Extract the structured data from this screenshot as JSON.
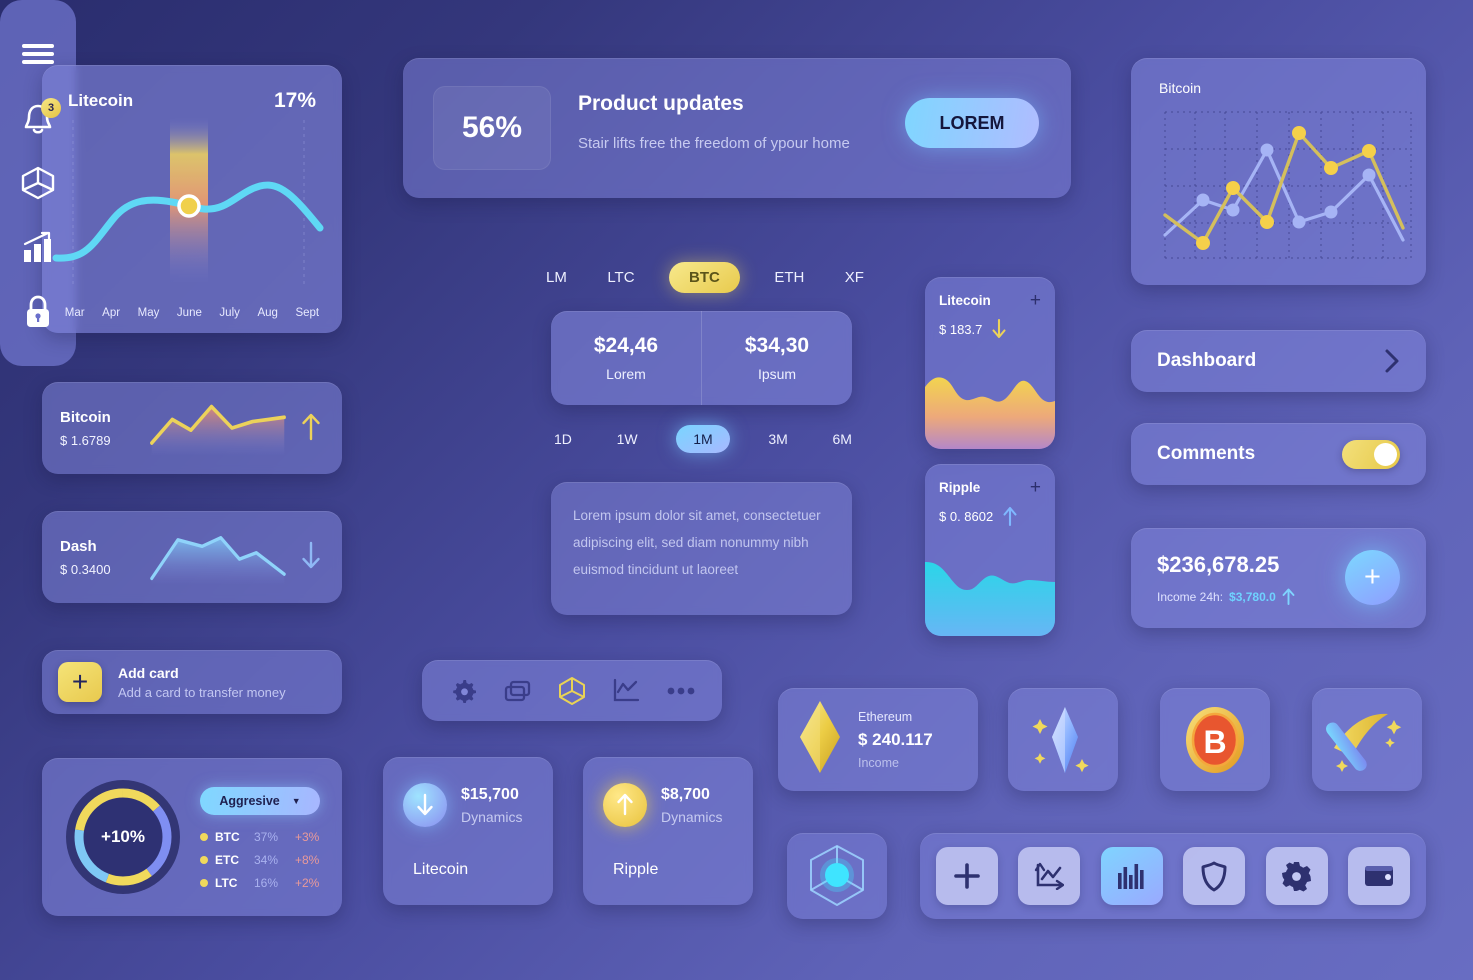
{
  "litecoin_chart": {
    "name": "Litecoin",
    "percent": "17%",
    "months": [
      "Mar",
      "Apr",
      "May",
      "June",
      "July",
      "Aug",
      "Sept"
    ]
  },
  "coin_rows": [
    {
      "name": "Bitcoin",
      "value": "$ 1.6789",
      "trend": "up",
      "arrow": "↑",
      "color": "#ecd25a"
    },
    {
      "name": "Dash",
      "value": "$ 0.3400",
      "trend": "down",
      "arrow": "↓",
      "color": "#7fc8f5"
    }
  ],
  "add_card": {
    "title": "Add card",
    "subtitle": "Add a card to transfer money",
    "plus": "+"
  },
  "portfolio": {
    "center_label": "+10%",
    "selector": "Aggresive",
    "chevron": "▼",
    "legend": [
      {
        "symbol": "BTC",
        "pct": "37%",
        "change": "+3%"
      },
      {
        "symbol": "ETC",
        "pct": "34%",
        "change": "+8%"
      },
      {
        "symbol": "LTC",
        "pct": "16%",
        "change": "+2%"
      }
    ]
  },
  "promo": {
    "percent": "56%",
    "title": "Product updates",
    "subtitle": "Stair lifts free the freedom of ypour home",
    "button": "LOREM"
  },
  "vnav": {
    "items": [
      "menu-icon",
      "bell-icon",
      "cube-icon",
      "bar-chart-icon",
      "lock-icon"
    ],
    "badge": "3"
  },
  "coin_tabs": {
    "items": [
      "LM",
      "LTC",
      "BTC",
      "ETH",
      "XF"
    ],
    "active": "BTC"
  },
  "price_pair": [
    {
      "value": "$24,46",
      "label": "Lorem"
    },
    {
      "value": "$34,30",
      "label": "Ipsum"
    }
  ],
  "range_tabs": {
    "items": [
      "1D",
      "1W",
      "1M",
      "3M",
      "6M"
    ],
    "active": "1M"
  },
  "lorem_block": "Lorem ipsum dolor sit amet, consectetuer adipiscing elit, sed diam nonummy nibh euismod tincidunt ut laoreet",
  "mini_cards": [
    {
      "name": "Litecoin",
      "price": "$ 183.7",
      "arrow": "↓",
      "plus": "+"
    },
    {
      "name": "Ripple",
      "price": "$ 0. 8602",
      "arrow": "↑",
      "plus": "+"
    }
  ],
  "bitcoin_chart": {
    "label": "Bitcoin"
  },
  "dashboard": {
    "label": "Dashboard",
    "chevron": "❯"
  },
  "comments": {
    "label": "Comments",
    "toggle_on": true
  },
  "balance": {
    "amount": "$236,678.25",
    "income_label": "Income 24h:",
    "income_value": "$3,780.0",
    "income_arrow": "↑",
    "fab": "+"
  },
  "icon_strip": {
    "items": [
      "gear-icon",
      "copy-icon",
      "cube-icon",
      "line-chart-icon",
      "more-icon"
    ],
    "active": "cube-icon"
  },
  "dynamics": [
    {
      "amount": "$15,700",
      "sub": "Dynamics",
      "name": "Litecoin",
      "arrow": "↓",
      "accent": "#7fbaff"
    },
    {
      "amount": "$8,700",
      "sub": "Dynamics",
      "name": "Ripple",
      "arrow": "↑",
      "accent": "#f0d44f"
    }
  ],
  "ethereum": {
    "name": "Ethereum",
    "price": "$ 240.117",
    "sub": "Income"
  },
  "tiles": [
    "crystal-icon",
    "bitcoin-coin-icon",
    "mining-pickaxe-icon"
  ],
  "bottom_toolbar": {
    "items": [
      "plus-icon",
      "line-chart-icon",
      "bar-chart-icon",
      "shield-icon",
      "gear-icon",
      "wallet-icon"
    ],
    "active": "bar-chart-icon"
  },
  "cube_tile": {
    "icon": "cube-glow-icon"
  },
  "colors": {
    "background_dark": "#2a2d6e",
    "background_light": "#686dc2",
    "card": "#7e83d7",
    "accent_yellow": "#ecd25a",
    "accent_blue": "#7fd4ff",
    "text": "#ffffff"
  },
  "chart_data": [
    {
      "type": "line",
      "title": "Litecoin",
      "x": [
        "Mar",
        "Apr",
        "May",
        "June",
        "July",
        "Aug",
        "Sept"
      ],
      "values": [
        18,
        22,
        58,
        55,
        52,
        68,
        46
      ],
      "ylim": [
        0,
        100
      ],
      "grid": false,
      "highlight_point": {
        "x": "June",
        "y": 55
      },
      "series_color": "#5fd8f5"
    },
    {
      "type": "area",
      "title": "Bitcoin",
      "values": [
        20,
        48,
        34,
        78,
        52,
        60,
        58,
        66
      ],
      "ylim": [
        0,
        100
      ],
      "series_color": "#ecd25a"
    },
    {
      "type": "area",
      "title": "Dash",
      "values": [
        18,
        72,
        62,
        70,
        42,
        50,
        34,
        22
      ],
      "ylim": [
        0,
        100
      ],
      "series_color": "#7fc8f5"
    },
    {
      "type": "line",
      "title": "Bitcoin",
      "x": [
        1,
        2,
        3,
        4,
        5,
        6,
        7,
        8,
        9
      ],
      "series": [
        {
          "name": "yellow",
          "values": [
            45,
            18,
            62,
            38,
            88,
            70,
            78,
            40,
            null
          ],
          "color": "#f5d04a"
        },
        {
          "name": "blue",
          "values": [
            30,
            44,
            48,
            17,
            55,
            50,
            64,
            22,
            null
          ],
          "color": "#a6b4f5"
        }
      ],
      "ylim": [
        0,
        100
      ],
      "grid": true,
      "legend": "none"
    },
    {
      "type": "area",
      "title": "Litecoin",
      "values": [
        72,
        78,
        55,
        48,
        58,
        52,
        70,
        66,
        52,
        55
      ],
      "ylim": [
        0,
        100
      ],
      "series_color": "#f0cf4e"
    },
    {
      "type": "area",
      "title": "Ripple",
      "values": [
        78,
        72,
        52,
        48,
        56,
        70,
        60,
        62,
        60,
        60
      ],
      "ylim": [
        0,
        100
      ],
      "series_color": "#45cdf0"
    },
    {
      "type": "pie",
      "title": "Portfolio",
      "center_label": "+10%",
      "categories": [
        "BTC",
        "ETC",
        "LTC"
      ],
      "values": [
        37,
        34,
        16
      ],
      "colors": [
        "#f0d95c",
        "#7b8bf0",
        "#7fc8f5"
      ]
    }
  ]
}
